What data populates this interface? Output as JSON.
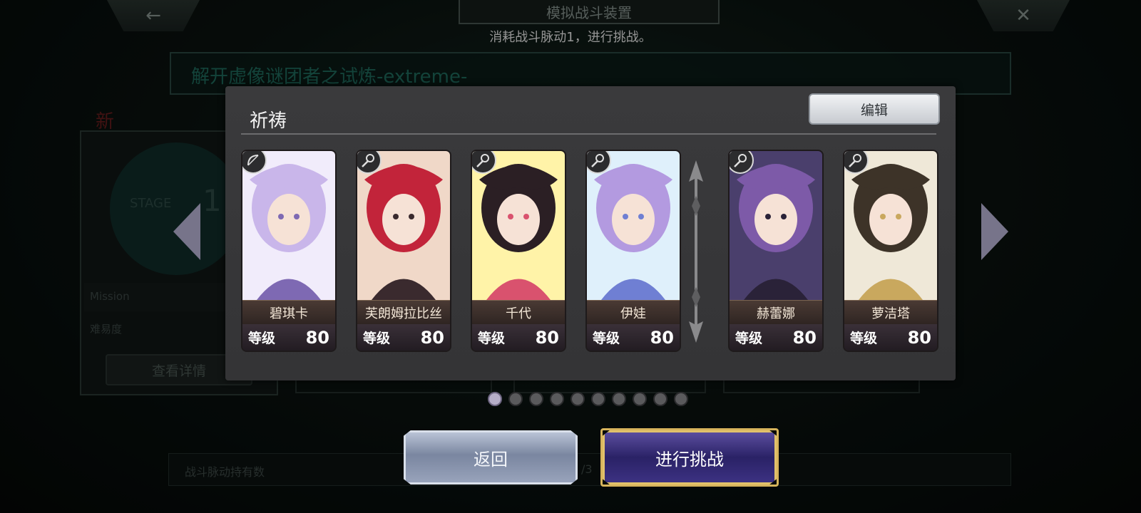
{
  "header": {
    "back_icon": "←",
    "close_icon": "✕",
    "title": "模拟战斗装置",
    "subtitle": "消耗战斗脉动1，进行挑战。"
  },
  "stage": {
    "banner": "解开虚像谜团者之试炼-extreme-",
    "new_tag": "新",
    "label": "STAGE",
    "number": "1",
    "mission_label": "Mission",
    "difficulty_label": "难易度",
    "detail_button": "查看详情"
  },
  "bottom_bar": {
    "label": "战斗脉动持有数",
    "count": "/3"
  },
  "modal": {
    "title": "祈祷",
    "edit_button": "编辑",
    "level_label": "等级",
    "cards": [
      {
        "name": "碧琪卡",
        "level": "80",
        "class_icon": "bow-icon",
        "colors": [
          "#f1ecfb",
          "#c9b6ea",
          "#7e69b3"
        ]
      },
      {
        "name": "芙朗姆拉比丝",
        "level": "80",
        "class_icon": "staff-icon",
        "colors": [
          "#f0d8c8",
          "#c2243a",
          "#3a2a2e"
        ]
      },
      {
        "name": "千代",
        "level": "80",
        "class_icon": "staff-icon",
        "colors": [
          "#fff3a8",
          "#2b1f24",
          "#d9526e"
        ]
      },
      {
        "name": "伊娃",
        "level": "80",
        "class_icon": "staff-icon",
        "colors": [
          "#dff0fb",
          "#b39ae0",
          "#6f7fd3"
        ]
      },
      {
        "name": "赫蕾娜",
        "level": "80",
        "class_icon": "staff-icon",
        "colors": [
          "#4a3f6c",
          "#7d5aa8",
          "#2a2238"
        ]
      },
      {
        "name": "萝洁塔",
        "level": "80",
        "class_icon": "staff-icon",
        "colors": [
          "#efe8d8",
          "#3d3328",
          "#c9a85e"
        ]
      }
    ]
  },
  "pagination": {
    "total": 10,
    "active": 1
  },
  "actions": {
    "back_button": "返回",
    "challenge_button": "进行挑战"
  },
  "colors": {
    "modal_bg": "#39393b",
    "accent_gold": "#d7b45c",
    "challenge_purple": "#2a2266"
  }
}
